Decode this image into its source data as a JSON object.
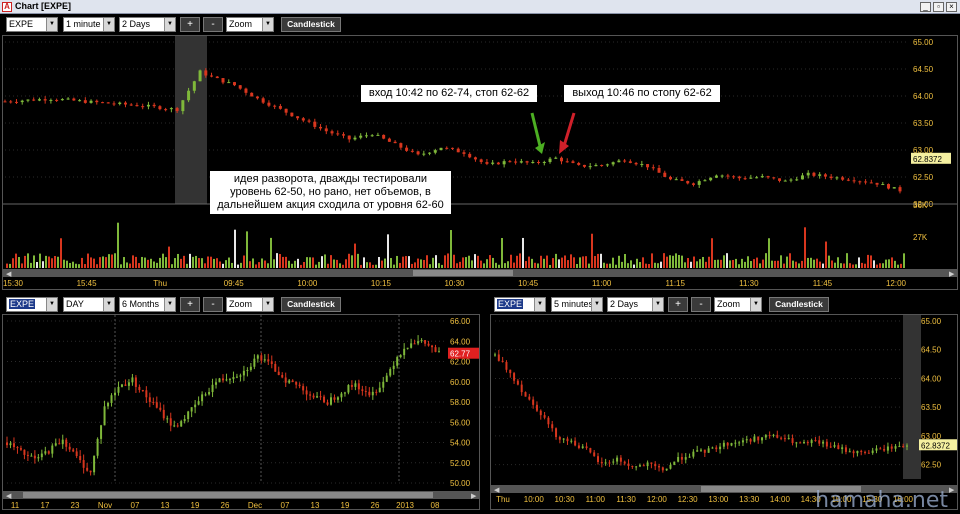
{
  "window": {
    "title": "Chart [EXPE]"
  },
  "top_toolbar": {
    "symbol": "EXPE",
    "interval": "1 minute",
    "range": "2 Days",
    "zoom": "Zoom",
    "type_button": "Candlestick",
    "zoom_in": "+",
    "zoom_out": "-"
  },
  "left_toolbar": {
    "symbol": "EXPE",
    "interval": "DAY",
    "range": "6 Months",
    "zoom": "Zoom",
    "type_button": "Candlestick",
    "zoom_in": "+",
    "zoom_out": "-"
  },
  "right_toolbar": {
    "symbol": "EXPE",
    "interval": "5 minutes",
    "range": "2 Days",
    "zoom": "Zoom",
    "type_button": "Candlestick",
    "zoom_in": "+",
    "zoom_out": "-"
  },
  "annotations": {
    "entry": "вход 10:42 по 62-74, стоп 62-62",
    "exit": "выход 10:46 по стопу 62-62",
    "idea": "идея разворота, дважды тестировали уровень 62-50, но рано, нет объемов, в дальнейшем акция сходила от уровня 62-60"
  },
  "watermark": "hamaha.net",
  "colors": {
    "up": "#7fb83a",
    "down": "#d8361e",
    "neutral": "#e8e8e8",
    "entry_arrow": "#4caf22",
    "exit_arrow": "#d0202a",
    "last_price_bg": "#f5f0a0",
    "last_price_red_bg": "#e02020"
  },
  "chart_data": [
    {
      "type": "candlestick",
      "name": "top-intraday-1min",
      "y_ticks": [
        "65.00",
        "64.50",
        "64.00",
        "63.50",
        "63.00",
        "62.50",
        "62.00"
      ],
      "ylim": [
        62.0,
        65.0
      ],
      "x_ticks": [
        "15:30",
        "15:45",
        "Thu",
        "09:45",
        "10:00",
        "10:15",
        "10:30",
        "10:45",
        "11:00",
        "11:15",
        "11:30",
        "11:45",
        "12:00"
      ],
      "last_price": "62.8372",
      "volume_ticks": [
        "36K",
        "27K"
      ],
      "close_path": [
        [
          0,
          63.9
        ],
        [
          8,
          63.95
        ],
        [
          16,
          63.88
        ],
        [
          24,
          63.82
        ],
        [
          30,
          63.75
        ],
        [
          32,
          64.1
        ],
        [
          34,
          64.45
        ],
        [
          36,
          64.35
        ],
        [
          40,
          64.2
        ],
        [
          44,
          63.95
        ],
        [
          48,
          63.75
        ],
        [
          52,
          63.55
        ],
        [
          56,
          63.35
        ],
        [
          60,
          63.2
        ],
        [
          64,
          63.3
        ],
        [
          68,
          63.1
        ],
        [
          72,
          62.9
        ],
        [
          76,
          63.05
        ],
        [
          80,
          62.95
        ],
        [
          84,
          62.72
        ],
        [
          88,
          62.8
        ],
        [
          92,
          62.75
        ],
        [
          96,
          62.85
        ],
        [
          100,
          62.7
        ],
        [
          104,
          62.72
        ],
        [
          108,
          62.82
        ],
        [
          112,
          62.7
        ],
        [
          116,
          62.45
        ],
        [
          120,
          62.38
        ],
        [
          124,
          62.55
        ],
        [
          128,
          62.48
        ],
        [
          132,
          62.5
        ],
        [
          136,
          62.42
        ],
        [
          140,
          62.55
        ],
        [
          144,
          62.5
        ],
        [
          148,
          62.45
        ],
        [
          152,
          62.38
        ],
        [
          156,
          62.25
        ]
      ]
    },
    {
      "type": "candlestick",
      "name": "daily-6-months",
      "y_ticks": [
        "66.00",
        "64.00",
        "62.00",
        "60.00",
        "58.00",
        "56.00",
        "54.00",
        "52.00",
        "50.00"
      ],
      "ylim": [
        50.0,
        66.0
      ],
      "x_ticks": [
        "11",
        "17",
        "23",
        "Nov",
        "07",
        "13",
        "19",
        "26",
        "Dec",
        "07",
        "13",
        "19",
        "26",
        "2013",
        "08"
      ],
      "last_price": "62.77",
      "close_path": [
        [
          0,
          54.0
        ],
        [
          4,
          53.0
        ],
        [
          8,
          52.3
        ],
        [
          12,
          53.2
        ],
        [
          16,
          54.3
        ],
        [
          20,
          52.5
        ],
        [
          24,
          51.0
        ],
        [
          28,
          57.5
        ],
        [
          32,
          59.5
        ],
        [
          36,
          60.2
        ],
        [
          40,
          58.5
        ],
        [
          44,
          57.0
        ],
        [
          48,
          55.5
        ],
        [
          52,
          56.8
        ],
        [
          56,
          58.5
        ],
        [
          60,
          60.0
        ],
        [
          64,
          60.5
        ],
        [
          68,
          61.0
        ],
        [
          72,
          62.5
        ],
        [
          76,
          61.5
        ],
        [
          80,
          60.2
        ],
        [
          84,
          59.5
        ],
        [
          88,
          58.5
        ],
        [
          92,
          58.0
        ],
        [
          96,
          59.0
        ],
        [
          100,
          59.8
        ],
        [
          104,
          58.5
        ],
        [
          108,
          60.0
        ],
        [
          112,
          62.5
        ],
        [
          116,
          64.0
        ],
        [
          120,
          63.8
        ],
        [
          124,
          62.77
        ]
      ]
    },
    {
      "type": "candlestick",
      "name": "intraday-5min",
      "y_ticks": [
        "65.00",
        "64.50",
        "64.00",
        "63.50",
        "63.00",
        "62.50"
      ],
      "ylim": [
        62.25,
        65.0
      ],
      "x_ticks": [
        "Thu",
        "10:00",
        "10:30",
        "11:00",
        "11:30",
        "12:00",
        "12:30",
        "13:00",
        "13:30",
        "14:00",
        "14:30",
        "15:00",
        "15:30",
        "16:00"
      ],
      "last_price": "62.8372",
      "close_path": [
        [
          0,
          64.4
        ],
        [
          4,
          64.1
        ],
        [
          8,
          63.7
        ],
        [
          12,
          63.4
        ],
        [
          16,
          63.0
        ],
        [
          20,
          62.9
        ],
        [
          24,
          62.75
        ],
        [
          28,
          62.5
        ],
        [
          32,
          62.6
        ],
        [
          36,
          62.45
        ],
        [
          40,
          62.5
        ],
        [
          44,
          62.4
        ],
        [
          48,
          62.6
        ],
        [
          52,
          62.7
        ],
        [
          56,
          62.75
        ],
        [
          60,
          62.85
        ],
        [
          64,
          62.9
        ],
        [
          68,
          62.95
        ],
        [
          72,
          63.0
        ],
        [
          76,
          62.95
        ],
        [
          80,
          62.85
        ],
        [
          84,
          62.9
        ],
        [
          88,
          62.82
        ],
        [
          92,
          62.75
        ],
        [
          96,
          62.7
        ],
        [
          100,
          62.75
        ],
        [
          104,
          62.8
        ],
        [
          108,
          62.84
        ]
      ]
    }
  ]
}
